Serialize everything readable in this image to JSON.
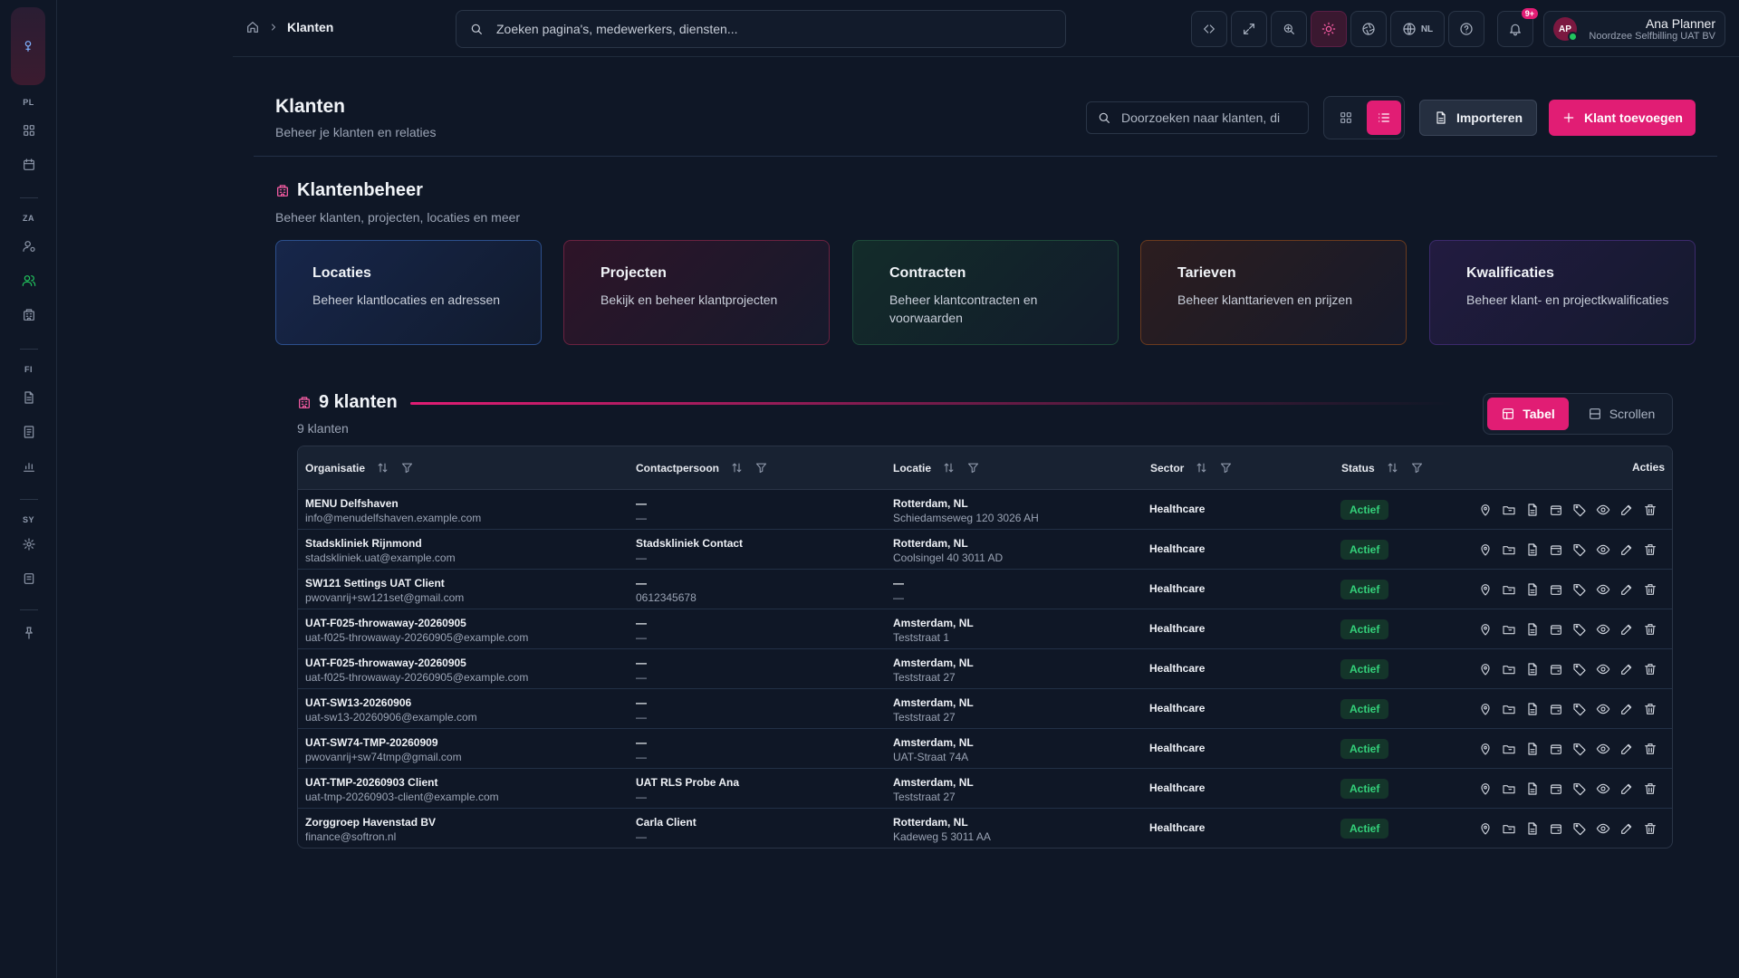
{
  "rail": {
    "sections": [
      "PL",
      "ZA",
      "FI",
      "SY"
    ]
  },
  "breadcrumb": {
    "current": "Klanten"
  },
  "global_search": {
    "placeholder": "Zoeken pagina's, medewerkers, diensten..."
  },
  "topbar": {
    "language": "NL",
    "notifications_badge": "9+"
  },
  "user": {
    "initials": "AP",
    "name": "Ana Planner",
    "org": "Noordzee Selfbilling UAT BV"
  },
  "page": {
    "title": "Klanten",
    "subtitle": "Beheer je klanten en relaties",
    "search_placeholder": "Doorzoeken naar klanten, di",
    "import_label": "Importeren",
    "add_label": "Klant toevoegen"
  },
  "section": {
    "title": "Klantenbeheer",
    "subtitle": "Beheer klanten, projecten, locaties en meer",
    "cards": [
      {
        "title": "Locaties",
        "desc": "Beheer klantlocaties en adressen"
      },
      {
        "title": "Projecten",
        "desc": "Bekijk en beheer klantprojecten"
      },
      {
        "title": "Contracten",
        "desc": "Beheer klantcontracten en voorwaarden"
      },
      {
        "title": "Tarieven",
        "desc": "Beheer klanttarieven en prijzen"
      },
      {
        "title": "Kwalificaties",
        "desc": "Beheer klant- en projectkwalificaties"
      }
    ]
  },
  "list": {
    "count_title": "9 klanten",
    "count_sub": "9 klanten",
    "mode_table": "Tabel",
    "mode_scroll": "Scrollen",
    "columns": [
      "Organisatie",
      "Contactpersoon",
      "Locatie",
      "Sector",
      "Status",
      "Acties"
    ],
    "rows": [
      {
        "org": "MENU Delfshaven",
        "email": "info@menudelfshaven.example.com",
        "contact": "—",
        "phone": "—",
        "city": "Rotterdam, NL",
        "address": "Schiedamseweg 120 3026 AH",
        "sector": "Healthcare",
        "status": "Actief"
      },
      {
        "org": "Stadskliniek Rijnmond",
        "email": "stadskliniek.uat@example.com",
        "contact": "Stadskliniek Contact",
        "phone": "—",
        "city": "Rotterdam, NL",
        "address": "Coolsingel 40 3011 AD",
        "sector": "Healthcare",
        "status": "Actief"
      },
      {
        "org": "SW121 Settings UAT Client",
        "email": "pwovanrij+sw121set@gmail.com",
        "contact": "—",
        "phone": "0612345678",
        "city": "—",
        "address": "—",
        "sector": "Healthcare",
        "status": "Actief"
      },
      {
        "org": "UAT-F025-throwaway-20260905",
        "email": "uat-f025-throwaway-20260905@example.com",
        "contact": "—",
        "phone": "—",
        "city": "Amsterdam, NL",
        "address": "Teststraat 1",
        "sector": "Healthcare",
        "status": "Actief"
      },
      {
        "org": "UAT-F025-throwaway-20260905",
        "email": "uat-f025-throwaway-20260905@example.com",
        "contact": "—",
        "phone": "—",
        "city": "Amsterdam, NL",
        "address": "Teststraat 27",
        "sector": "Healthcare",
        "status": "Actief"
      },
      {
        "org": "UAT-SW13-20260906",
        "email": "uat-sw13-20260906@example.com",
        "contact": "—",
        "phone": "—",
        "city": "Amsterdam, NL",
        "address": "Teststraat 27",
        "sector": "Healthcare",
        "status": "Actief"
      },
      {
        "org": "UAT-SW74-TMP-20260909",
        "email": "pwovanrij+sw74tmp@gmail.com",
        "contact": "—",
        "phone": "—",
        "city": "Amsterdam, NL",
        "address": "UAT-Straat 74A",
        "sector": "Healthcare",
        "status": "Actief"
      },
      {
        "org": "UAT-TMP-20260903 Client",
        "email": "uat-tmp-20260903-client@example.com",
        "contact": "UAT RLS Probe Ana",
        "phone": "—",
        "city": "Amsterdam, NL",
        "address": "Teststraat 27",
        "sector": "Healthcare",
        "status": "Actief"
      },
      {
        "org": "Zorggroep Havenstad BV",
        "email": "finance@softron.nl",
        "contact": "Carla Client",
        "phone": "—",
        "city": "Rotterdam, NL",
        "address": "Kadeweg 5 3011 AA",
        "sector": "Healthcare",
        "status": "Actief"
      }
    ]
  }
}
